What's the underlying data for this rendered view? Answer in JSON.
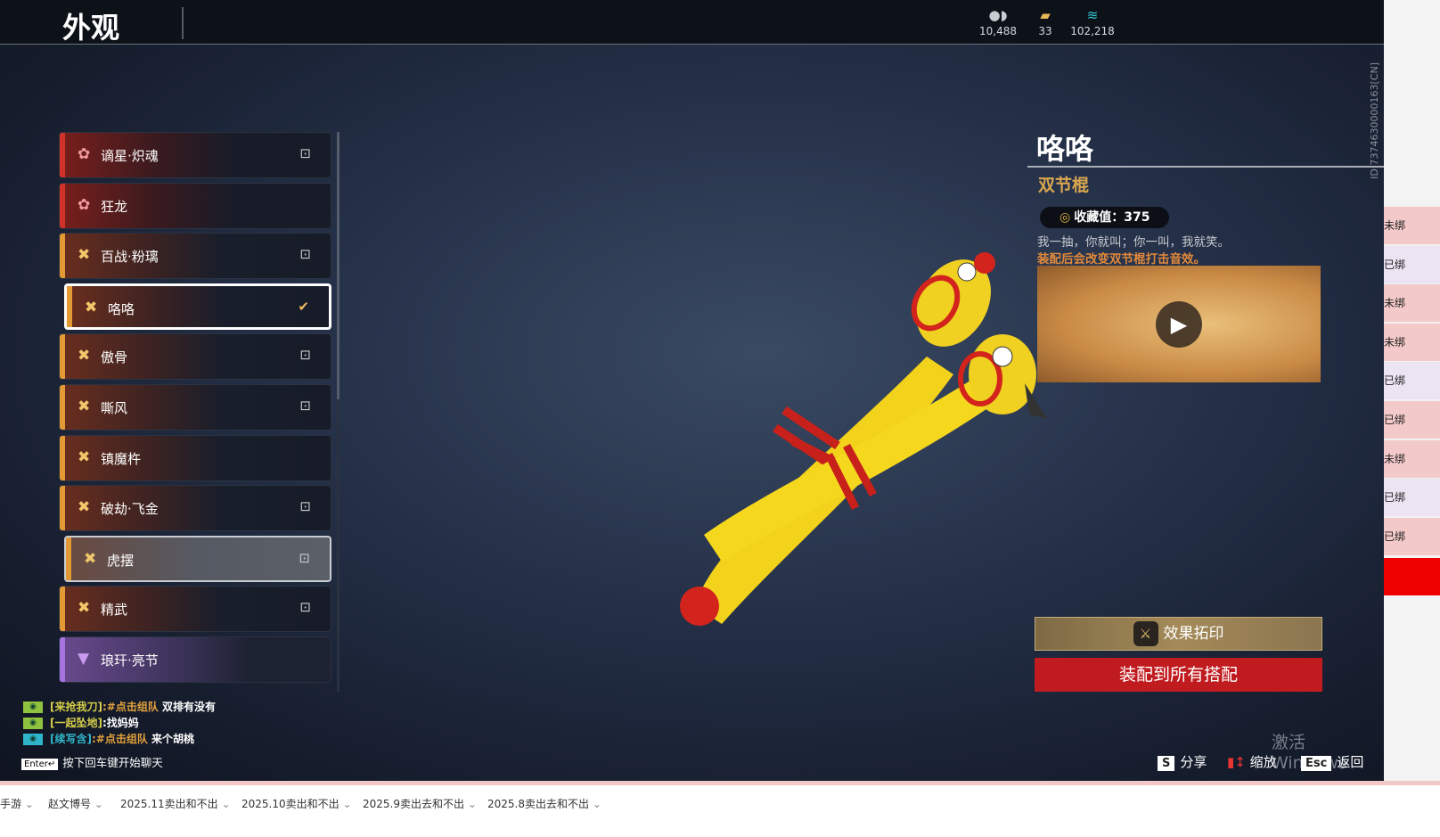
{
  "header": {
    "title": "外观",
    "currencies": [
      {
        "icon": "coin-icon",
        "value": "10,488"
      },
      {
        "icon": "gold-ticket-icon",
        "value": "33"
      },
      {
        "icon": "feather-icon",
        "value": "102,218"
      }
    ]
  },
  "uid": "ID:7374630000163[CN]",
  "list": [
    {
      "label": "谪星·炽魂",
      "rarity": "red",
      "status": "locked"
    },
    {
      "label": "狂龙",
      "rarity": "red",
      "status": ""
    },
    {
      "label": "百战·粉璃",
      "rarity": "orange",
      "status": "locked"
    },
    {
      "label": "咯咯",
      "rarity": "orange",
      "status": "selected"
    },
    {
      "label": "傲骨",
      "rarity": "orange",
      "status": "locked"
    },
    {
      "label": "嘶风",
      "rarity": "orange",
      "status": "locked"
    },
    {
      "label": "镇魔杵",
      "rarity": "orange",
      "status": ""
    },
    {
      "label": "破劫·飞金",
      "rarity": "orange",
      "status": "locked"
    },
    {
      "label": "虎摆",
      "rarity": "orange",
      "status": "locked"
    },
    {
      "label": "精武",
      "rarity": "orange",
      "status": "locked"
    },
    {
      "label": "琅玕·亮节",
      "rarity": "purple",
      "status": ""
    }
  ],
  "detail": {
    "name": "咯咯",
    "type": "双节棍",
    "collect_label": "收藏值：375",
    "desc": "我一抽，你就叫；你一叫，我就笑。",
    "note": "装配后会改变双节棍打击音效。",
    "effect_button": "效果拓印",
    "equip_button": "装配到所有搭配"
  },
  "chat": [
    {
      "name": "[来抢我刀]",
      "tag": ":#点击组队",
      "msg": " 双排有没有"
    },
    {
      "name": "[一起坠地]",
      "tag": "",
      "msg": ":找妈妈"
    },
    {
      "name": "[续写含]",
      "tag": ":#点击组队",
      "msg": " 来个胡桃"
    }
  ],
  "enter_key": "Enter↵",
  "enter_hint": "按下回车键开始聊天",
  "hints": {
    "share_key": "S",
    "share": "分享",
    "zoom": "缩放",
    "esc_key": "Esc",
    "back": "返回"
  },
  "watermark": "激活 Windows",
  "right_strip": [
    "未绑",
    "已绑",
    "未绑",
    "未绑",
    "已绑",
    "已绑",
    "未绑",
    "已绑",
    "已绑"
  ],
  "taskbar": [
    "手游",
    "赵文博号",
    "2025.11卖出和不出",
    "2025.10卖出和不出",
    "2025.9卖出去和不出",
    "2025.8卖出去和不出"
  ],
  "colors": {
    "accent_red": "#c01c20",
    "gold": "#d9a650",
    "orange_note": "#e2893a"
  }
}
